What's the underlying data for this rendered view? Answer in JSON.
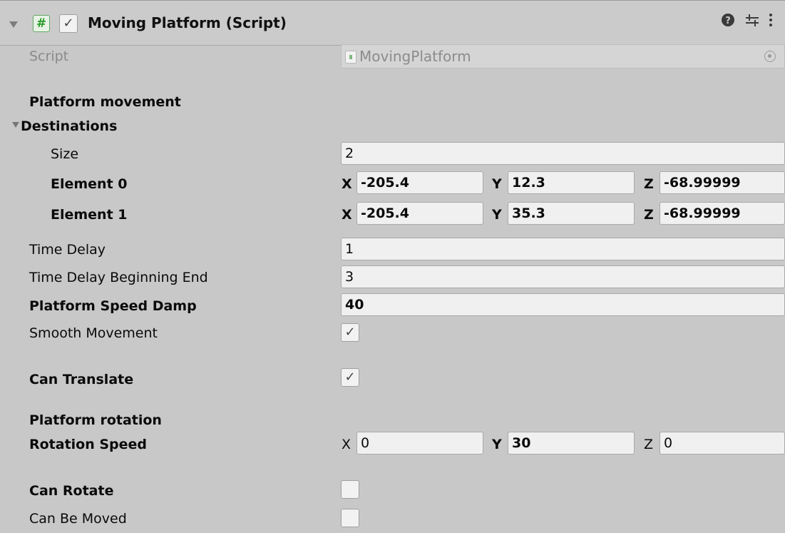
{
  "header": {
    "title": "Moving Platform (Script)",
    "enabled_check": "✓",
    "script_icon_glyph": "#",
    "help_icon": "help-icon",
    "presets_icon": "presets-icon",
    "menu_icon": "kebab-menu-icon"
  },
  "script_field": {
    "label": "Script",
    "value": "MovingPlatform"
  },
  "sections": {
    "movement_header": "Platform movement",
    "destinations": "Destinations",
    "rotation_header": "Platform rotation"
  },
  "destinations": {
    "size_label": "Size",
    "size_value": "2",
    "elements": [
      {
        "label": "Element 0",
        "x": "-205.4",
        "y": "12.3",
        "z": "-68.99999"
      },
      {
        "label": "Element 1",
        "x": "-205.4",
        "y": "35.3",
        "z": "-68.99999"
      }
    ]
  },
  "axes": {
    "x": "X",
    "y": "Y",
    "z": "Z"
  },
  "fields": {
    "time_delay": {
      "label": "Time Delay",
      "value": "1"
    },
    "time_delay_beginning_end": {
      "label": "Time Delay Beginning End",
      "value": "3"
    },
    "platform_speed_damp": {
      "label": "Platform Speed Damp",
      "value": "40"
    },
    "smooth_movement": {
      "label": "Smooth Movement",
      "checked": "✓"
    },
    "can_translate": {
      "label": "Can Translate",
      "checked": "✓"
    },
    "rotation_speed": {
      "label": "Rotation Speed",
      "x": "0",
      "y": "30",
      "z": "0"
    },
    "can_rotate": {
      "label": "Can Rotate",
      "checked": ""
    },
    "can_be_moved": {
      "label": "Can Be Moved",
      "checked": ""
    }
  },
  "colors": {
    "background": "#c8c8c8",
    "field_background": "#f0f0f0",
    "script_icon_green": "#2b9d2b"
  }
}
